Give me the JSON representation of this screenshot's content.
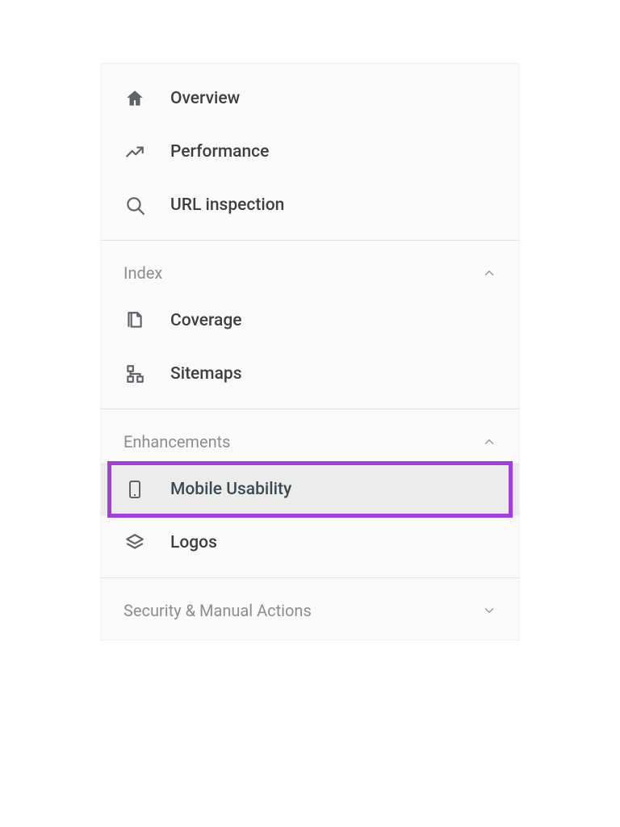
{
  "colors": {
    "highlight_border": "#a23fd8",
    "icon": "#5f6368",
    "text": "#3c4043",
    "muted": "#8d8d8d",
    "selected_bg": "#ececec"
  },
  "nav": {
    "top": [
      {
        "label": "Overview",
        "icon": "home-icon"
      },
      {
        "label": "Performance",
        "icon": "trend-icon"
      },
      {
        "label": "URL inspection",
        "icon": "search-icon"
      }
    ],
    "sections": [
      {
        "title": "Index",
        "expanded": true,
        "items": [
          {
            "label": "Coverage",
            "icon": "pages-icon"
          },
          {
            "label": "Sitemaps",
            "icon": "sitemap-icon"
          }
        ]
      },
      {
        "title": "Enhancements",
        "expanded": true,
        "items": [
          {
            "label": "Mobile Usability",
            "icon": "mobile-icon",
            "selected": true,
            "highlighted": true
          },
          {
            "label": "Logos",
            "icon": "layers-icon"
          }
        ]
      },
      {
        "title": "Security & Manual Actions",
        "expanded": false,
        "items": []
      }
    ]
  }
}
